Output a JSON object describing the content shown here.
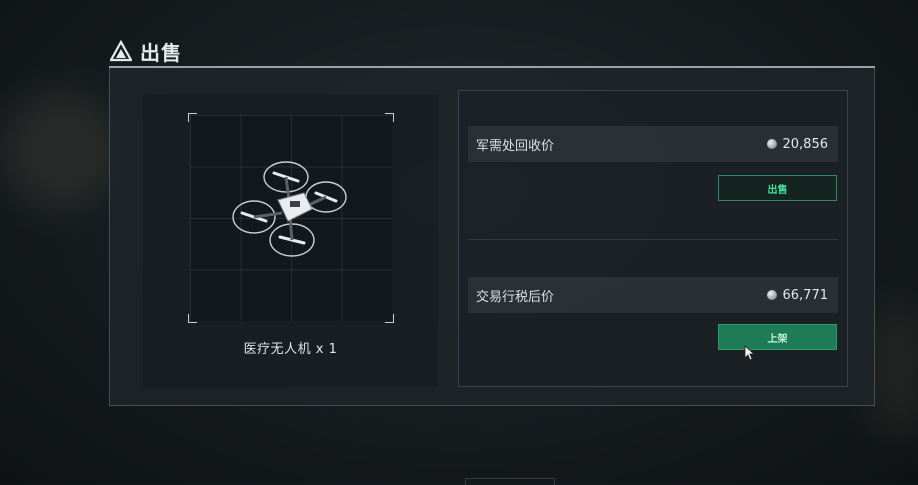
{
  "header": {
    "title": "出售",
    "icon": "triangle-logo-icon"
  },
  "item": {
    "name": "医疗无人机 x 1",
    "image": "drone-icon"
  },
  "recycle": {
    "label": "军需处回收价",
    "price": "20,856",
    "button_label": "出售"
  },
  "market": {
    "label": "交易行税后价",
    "price": "66,771",
    "button_label": "上架"
  },
  "colors": {
    "accent_green": "#3fe09a",
    "button_filled": "#1f7a57",
    "panel_border": "#aebdc4"
  }
}
